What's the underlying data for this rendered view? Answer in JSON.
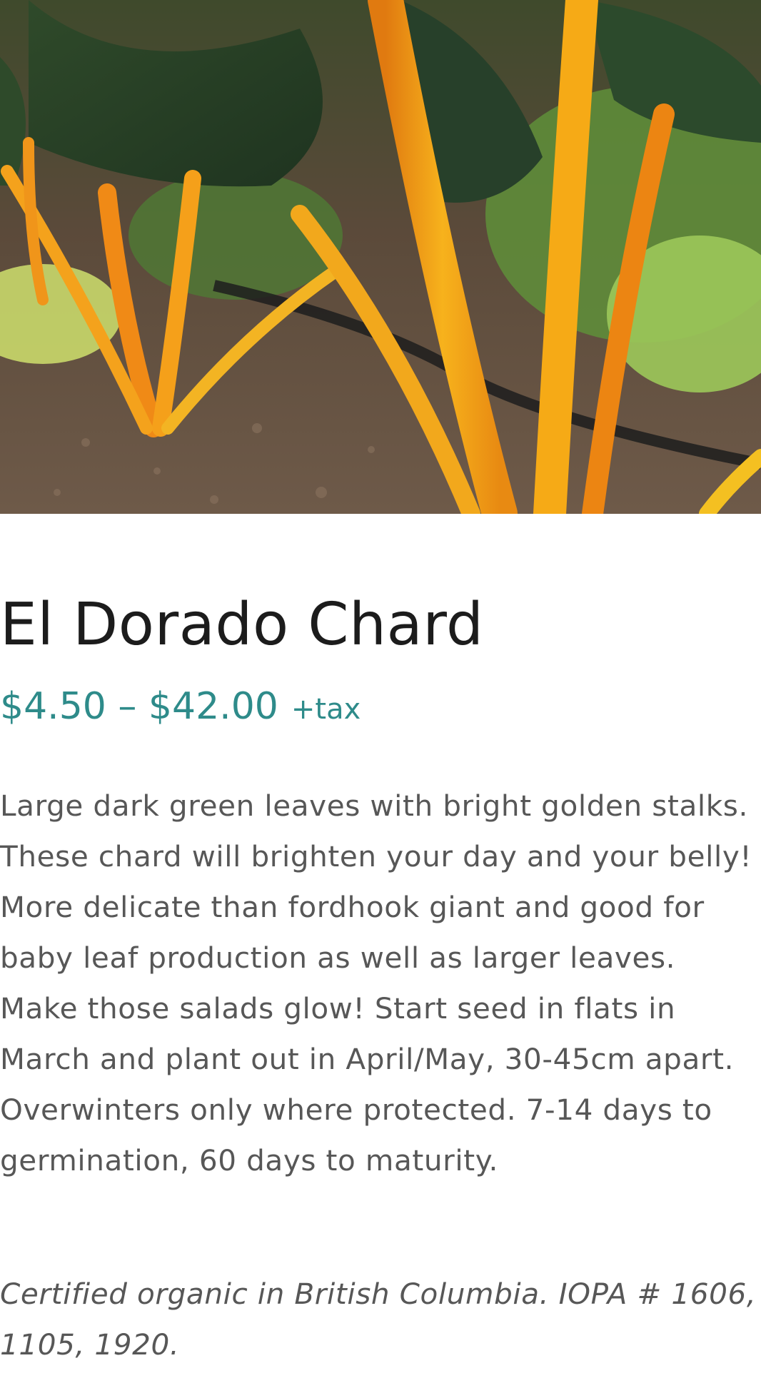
{
  "product": {
    "image_alt": "El Dorado Chard plants with golden stalks",
    "title": "El Dorado Chard",
    "price_range": "$4.50 – $42.00",
    "price_suffix": "+tax",
    "description": "Large dark green leaves with bright golden stalks. These chard will brighten your day and your belly! More delicate than fordhook giant and good for baby leaf production as well as larger leaves. Make those salads glow! Start seed in flats in March and plant out in April/May, 30-45cm apart. Overwinters only where protected. 7-14 days to germination, 60 days to maturity.",
    "certification": "Certified organic in British Columbia. IOPA # 1606, 1105, 1920."
  },
  "colors": {
    "title": "#1c1c1c",
    "price": "#2e8b8a",
    "body_text": "#575757",
    "background": "#ffffff"
  }
}
